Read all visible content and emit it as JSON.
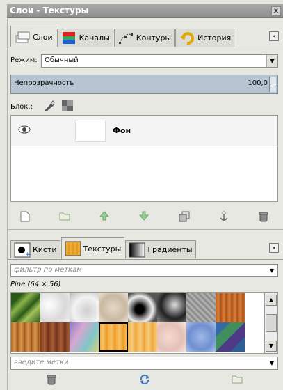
{
  "window": {
    "title": "Слои - Текстуры",
    "close_label": "x"
  },
  "top_tabs": [
    {
      "label": "Слои",
      "icon": "layers-icon",
      "active": true
    },
    {
      "label": "Каналы",
      "icon": "channels-icon",
      "active": false
    },
    {
      "label": "Контуры",
      "icon": "paths-icon",
      "active": false
    },
    {
      "label": "История",
      "icon": "history-icon",
      "active": false
    }
  ],
  "layers": {
    "mode_label": "Режим:",
    "mode_value": "Обычный",
    "opacity_label": "Непрозрачность",
    "opacity_value": "100,0",
    "lock_label": "Блок.:",
    "items": [
      {
        "name": "Фон",
        "visible": true
      }
    ],
    "buttons": [
      "new-layer-icon",
      "new-group-icon",
      "raise-layer-icon",
      "lower-layer-icon",
      "duplicate-layer-icon",
      "anchor-icon",
      "delete-layer-icon"
    ]
  },
  "bottom_tabs": [
    {
      "label": "Кисти",
      "icon": "brushes-icon",
      "active": false
    },
    {
      "label": "Текстуры",
      "icon": "patterns-icon",
      "active": true
    },
    {
      "label": "Градиенты",
      "icon": "gradients-icon",
      "active": false
    }
  ],
  "patterns": {
    "filter_placeholder": "фильтр по меткам",
    "selected_info": "Pine (64 × 56)",
    "tags_placeholder": "введите метки",
    "buttons": [
      "delete-pattern-icon",
      "refresh-icon",
      "open-folder-icon"
    ]
  },
  "colors": {
    "title_bg": "#999999",
    "opacity_bg": "#b6c5d1",
    "panel_bg": "#e8e8e2",
    "accent_green": "#6aa84f"
  }
}
